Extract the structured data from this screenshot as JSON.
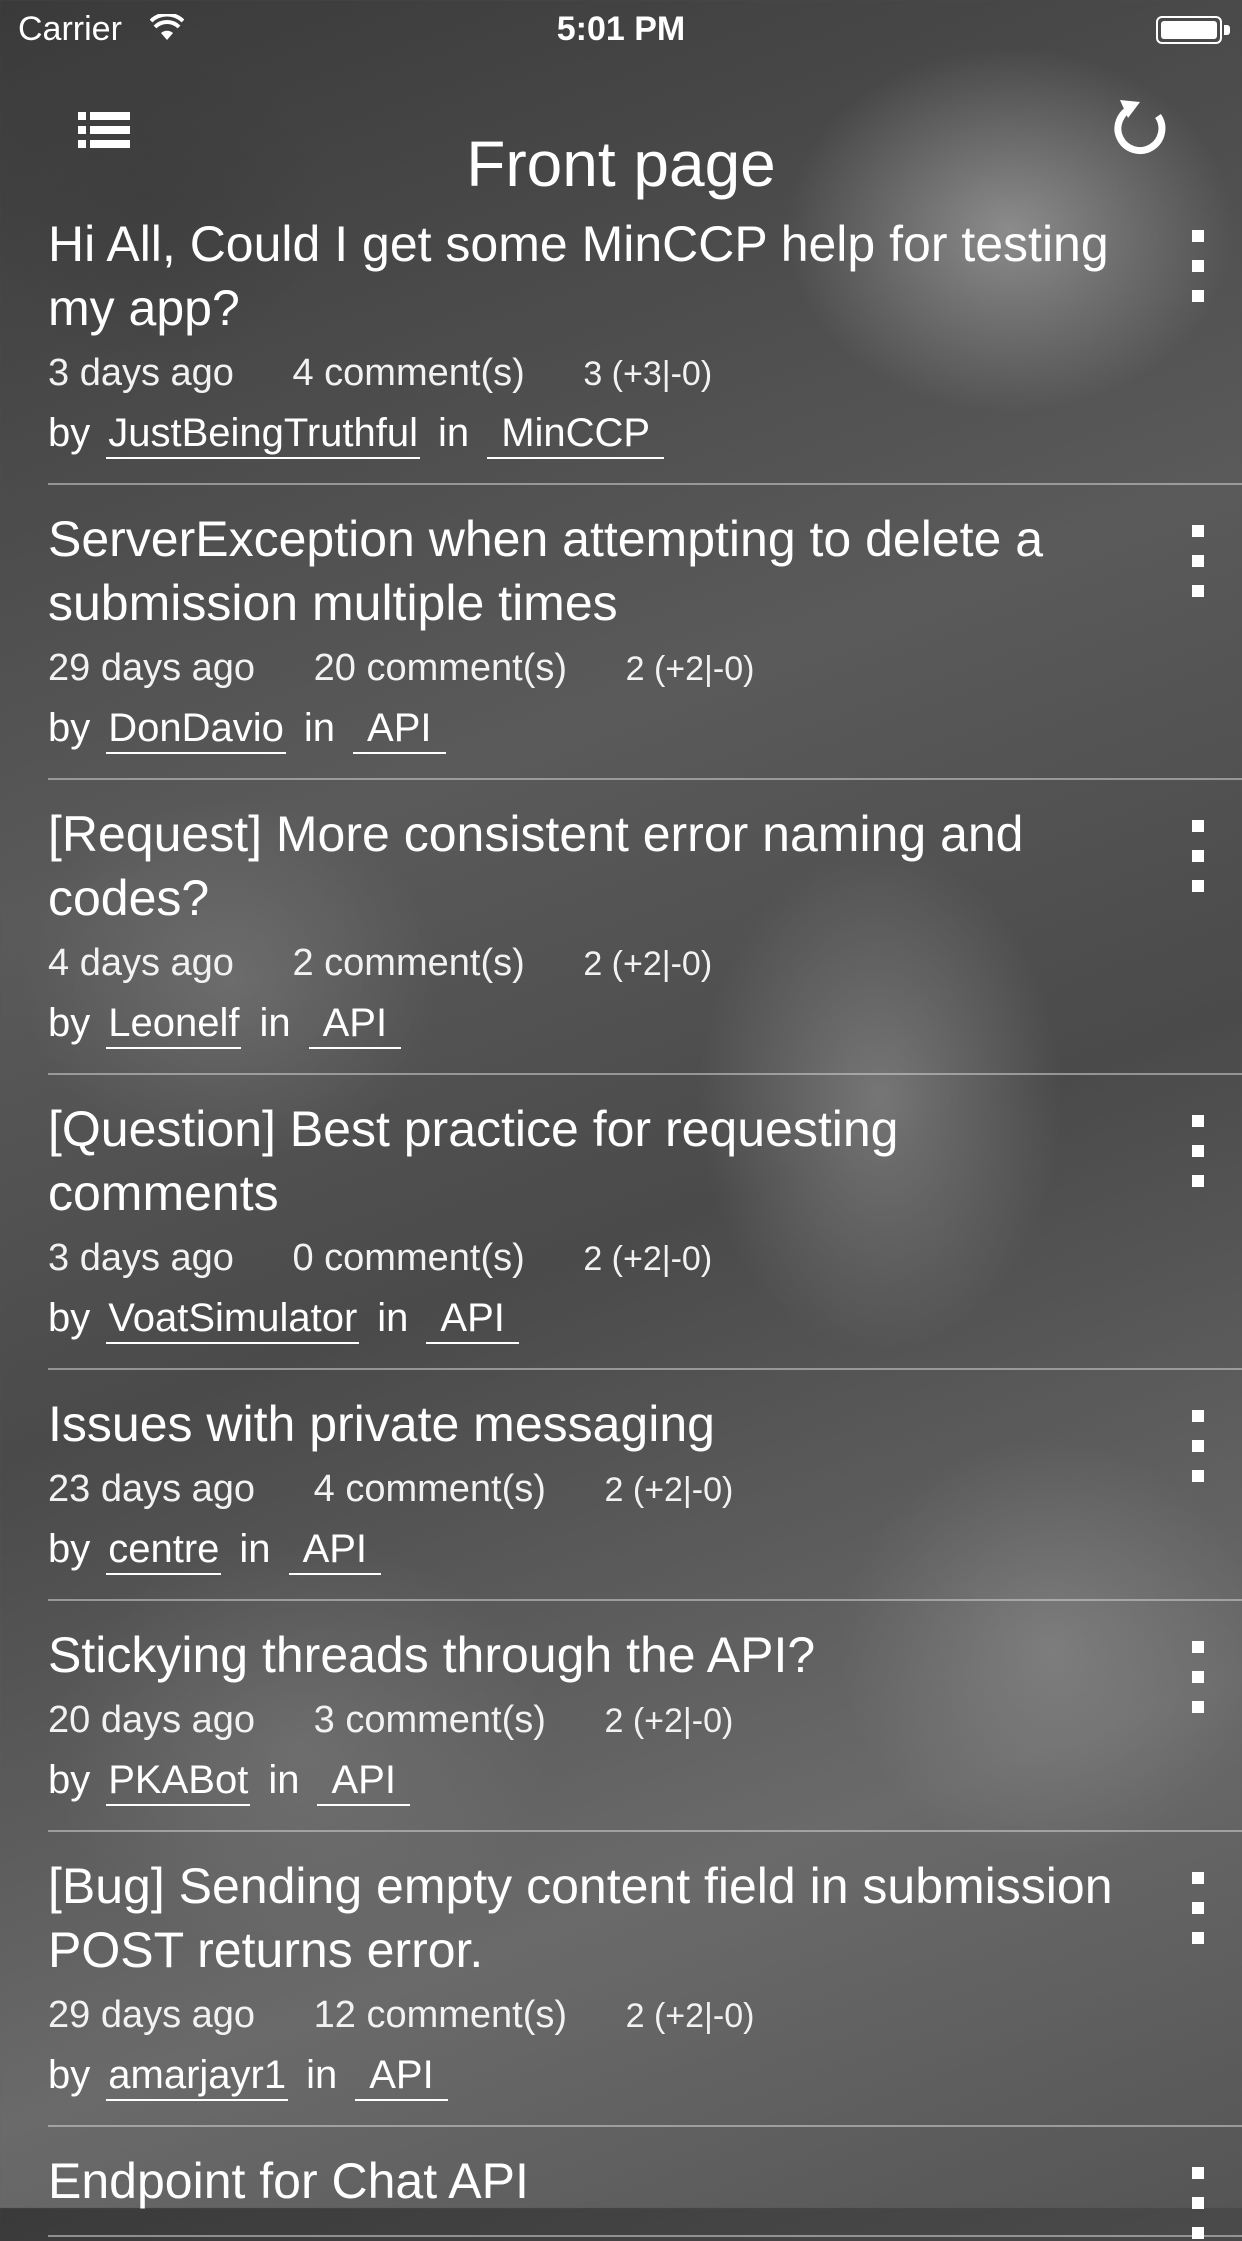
{
  "status_bar": {
    "carrier": "Carrier",
    "time": "5:01 PM"
  },
  "nav": {
    "title": "Front page",
    "menu_icon": "list-icon",
    "refresh_icon": "refresh-icon"
  },
  "labels": {
    "by": "by",
    "in": "in"
  },
  "posts": [
    {
      "title": "Hi All, Could I get some MinCCP help for testing my app?",
      "age": "3 days ago",
      "comments": "4 comment(s)",
      "score": "3 (+3|-0)",
      "author": "JustBeingTruthful",
      "subverse": "MinCCP"
    },
    {
      "title": "ServerException when attempting to delete a submission multiple times",
      "age": "29 days ago",
      "comments": "20 comment(s)",
      "score": "2 (+2|-0)",
      "author": "DonDavio",
      "subverse": "API"
    },
    {
      "title": "[Request] More consistent error naming and codes?",
      "age": "4 days ago",
      "comments": "2 comment(s)",
      "score": "2 (+2|-0)",
      "author": "Leonelf",
      "subverse": "API"
    },
    {
      "title": "[Question] Best practice for requesting comments",
      "age": "3 days ago",
      "comments": "0 comment(s)",
      "score": "2 (+2|-0)",
      "author": "VoatSimulator",
      "subverse": "API"
    },
    {
      "title": "Issues with private messaging",
      "age": "23 days ago",
      "comments": "4 comment(s)",
      "score": "2 (+2|-0)",
      "author": "centre",
      "subverse": "API"
    },
    {
      "title": "Stickying threads through the API?",
      "age": "20 days ago",
      "comments": "3 comment(s)",
      "score": "2 (+2|-0)",
      "author": "PKABot",
      "subverse": "API"
    },
    {
      "title": "[Bug] Sending empty content field in submission POST returns error.",
      "age": "29 days ago",
      "comments": "12 comment(s)",
      "score": "2 (+2|-0)",
      "author": "amarjayr1",
      "subverse": "API"
    },
    {
      "title": "Endpoint for Chat API",
      "age": "",
      "comments": "",
      "score": "",
      "author": "",
      "subverse": ""
    }
  ]
}
